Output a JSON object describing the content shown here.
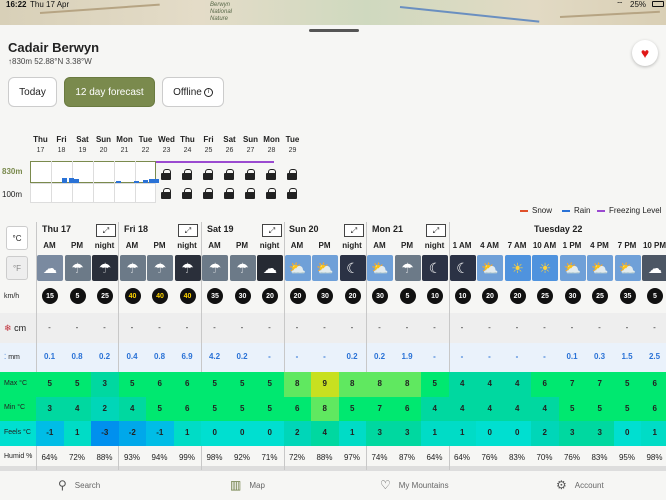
{
  "status": {
    "time": "16:22",
    "date": "Thu 17 Apr",
    "battery": "25%"
  },
  "map": {
    "label": "Berwyn National Nature"
  },
  "location": {
    "title": "Cadair Berwyn",
    "coords": "↑830m 52.88°N 3.38°W"
  },
  "tabs": [
    {
      "label": "Today"
    },
    {
      "label": "12 day forecast"
    },
    {
      "label": "Offline"
    }
  ],
  "overview": {
    "days": [
      "Thu",
      "Fri",
      "Sat",
      "Sun",
      "Mon",
      "Tue",
      "Wed",
      "Thu",
      "Fri",
      "Sat",
      "Sun",
      "Mon",
      "Tue"
    ],
    "dates": [
      "17",
      "18",
      "19",
      "20",
      "21",
      "22",
      "23",
      "24",
      "25",
      "26",
      "27",
      "28",
      "29"
    ],
    "alt_top": "830m",
    "alt_bottom": "100m"
  },
  "legend": {
    "snow": "Snow",
    "rain": "Rain",
    "freezing": "Freezing Level",
    "snow_color": "#e0502a",
    "rain_color": "#2a72d6",
    "freezing_color": "#9a4ad0"
  },
  "units": {
    "temp_c": "°C",
    "temp_f": "°F",
    "wind": "km/h",
    "snow": "cm",
    "rain": "mm"
  },
  "day_heads": [
    {
      "label": "Thu 17"
    },
    {
      "label": "Fri 18"
    },
    {
      "label": "Sat 19"
    },
    {
      "label": "Sun 20"
    },
    {
      "label": "Mon 21"
    },
    {
      "label": "Tuesday 22"
    }
  ],
  "expand_icon": "⤢",
  "hours": [
    "AM",
    "PM",
    "night",
    "AM",
    "PM",
    "night",
    "AM",
    "PM",
    "night",
    "AM",
    "PM",
    "night",
    "AM",
    "PM",
    "night",
    "1 AM",
    "4 AM",
    "7 AM",
    "10 AM",
    "1 PM",
    "4 PM",
    "7 PM",
    "10 PM"
  ],
  "weather_icons": [
    "partly-cloudy",
    "cloud-rain",
    "cloud-night-rain",
    "cloud-rain",
    "cloud-rain",
    "cloud-night-rain",
    "cloud-rain",
    "cloud-rain",
    "cloud-night",
    "sun-cloud",
    "sun-cloud",
    "moon-cloud",
    "sun-cloud",
    "cloud-rain",
    "moon-cloud",
    "moon-cloud",
    "sun-cloud",
    "sun",
    "sun",
    "sun-cloud",
    "sun-cloud",
    "sun-cloud",
    "cloud"
  ],
  "wind": [
    "15",
    "5",
    "25",
    "40",
    "40",
    "40",
    "35",
    "30",
    "20",
    "20",
    "30",
    "20",
    "30",
    "5",
    "10",
    "10",
    "20",
    "20",
    "25",
    "30",
    "25",
    "35",
    "5"
  ],
  "wind_yellow": [
    false,
    false,
    false,
    true,
    true,
    true,
    false,
    false,
    false,
    false,
    false,
    false,
    false,
    false,
    false,
    false,
    false,
    false,
    false,
    false,
    false,
    false,
    false
  ],
  "snow": [
    "-",
    "-",
    "-",
    "-",
    "-",
    "-",
    "-",
    "-",
    "-",
    "-",
    "-",
    "-",
    "-",
    "-",
    "-",
    "-",
    "-",
    "-",
    "-",
    "-",
    "-",
    "-",
    "-"
  ],
  "rain": [
    "0.1",
    "0.8",
    "0.2",
    "0.4",
    "0.8",
    "6.9",
    "4.2",
    "0.2",
    "-",
    "-",
    "-",
    "0.2",
    "0.2",
    "1.9",
    "-",
    "-",
    "-",
    "-",
    "-",
    "0.1",
    "0.3",
    "1.5",
    "2.5"
  ],
  "row_labels": {
    "max": "Max °C",
    "min": "Min °C",
    "feels": "Feels °C",
    "humid": "Humid %"
  },
  "max": [
    "5",
    "5",
    "3",
    "5",
    "6",
    "6",
    "5",
    "5",
    "5",
    "8",
    "9",
    "8",
    "8",
    "8",
    "5",
    "4",
    "4",
    "4",
    "6",
    "7",
    "7",
    "5",
    "6"
  ],
  "min": [
    "3",
    "4",
    "2",
    "4",
    "5",
    "6",
    "5",
    "5",
    "5",
    "6",
    "8",
    "5",
    "7",
    "6",
    "4",
    "4",
    "4",
    "4",
    "4",
    "5",
    "5",
    "5",
    "6"
  ],
  "feels": [
    "-1",
    "1",
    "-3",
    "-2",
    "-1",
    "1",
    "0",
    "0",
    "0",
    "2",
    "4",
    "1",
    "3",
    "3",
    "1",
    "1",
    "0",
    "0",
    "2",
    "3",
    "3",
    "0",
    "1"
  ],
  "humid": [
    "64%",
    "72%",
    "88%",
    "93%",
    "94%",
    "99%",
    "98%",
    "92%",
    "71%",
    "72%",
    "88%",
    "97%",
    "74%",
    "87%",
    "64%",
    "64%",
    "76%",
    "83%",
    "70%",
    "76%",
    "83%",
    "95%",
    "98%"
  ],
  "nav": [
    {
      "label": "Search"
    },
    {
      "label": "Map"
    },
    {
      "label": "My Mountains"
    },
    {
      "label": "Account"
    }
  ]
}
